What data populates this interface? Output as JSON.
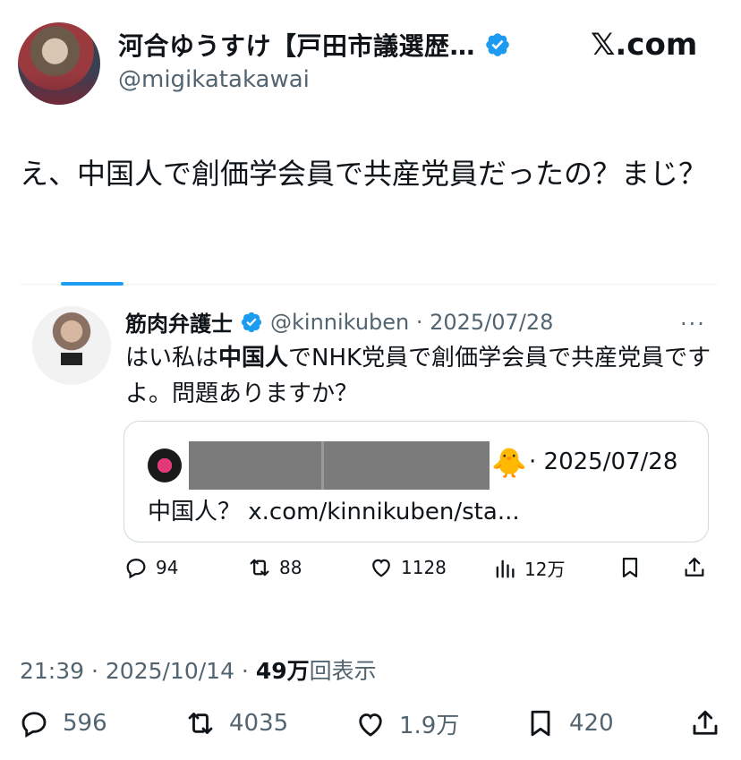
{
  "header": {
    "display_name": "河合ゆうすけ【戸田市議選歴…",
    "handle": "@migikatakawai",
    "site": "𝕏.com"
  },
  "tweet": {
    "text": "え、中国人で創価学会員で共産党員だったの？まじ？"
  },
  "reply": {
    "name": "筋肉弁護士",
    "handle_date": "@kinnikuben · 2025/07/28",
    "text_pre": "はい私は",
    "text_bold": "中国人",
    "text_post": "でNHK党員で創価学会員で共産党員ですよ。問題ありますか？",
    "more": "···"
  },
  "quote": {
    "emoji": "🐥",
    "date": "· 2025/07/28",
    "text": "中国人？ x.com/kinnikuben/sta..."
  },
  "inner_actions": {
    "replies": "94",
    "reposts": "88",
    "likes": "1128",
    "views": "12万"
  },
  "meta": {
    "time_date": "21:39 · 2025/10/14 · ",
    "views_count": "49万",
    "views_label": "回表示"
  },
  "bottom_actions": {
    "replies": "596",
    "reposts": "4035",
    "likes": "1.9万",
    "bookmarks": "420"
  },
  "colors": {
    "accent": "#1d9bf0",
    "text": "#0f1419",
    "muted": "#536471",
    "border": "#cfd9de"
  }
}
